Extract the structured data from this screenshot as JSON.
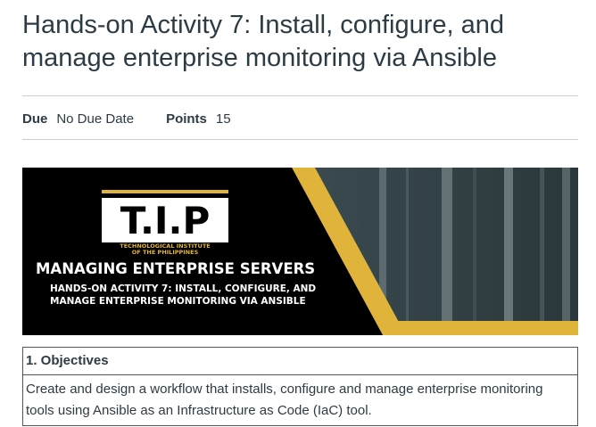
{
  "assignment": {
    "title": "Hands-on Activity 7: Install, configure, and manage enterprise monitoring via Ansible",
    "due_label": "Due",
    "due_value": "No Due Date",
    "points_label": "Points",
    "points_value": "15"
  },
  "banner": {
    "logo_text": "T.I.P",
    "logo_sub1": "TECHNOLOGICAL INSTITUTE",
    "logo_sub2": "OF THE PHILIPPINES",
    "heading": "MANAGING ENTERPRISE SERVERS",
    "sub_line1": "HANDS-ON ACTIVITY 7: INSTALL, CONFIGURE, AND",
    "sub_line2": "MANAGE ENTERPRISE MONITORING VIA ANSIBLE",
    "colors": {
      "gold": "#e0b43a",
      "black": "#000000"
    }
  },
  "content": {
    "objectives_heading": "1. Objectives",
    "objectives_text": "Create and design a workflow that installs, configure and manage enterprise monitoring tools using Ansible as an Infrastructure as Code (IaC) tool."
  }
}
